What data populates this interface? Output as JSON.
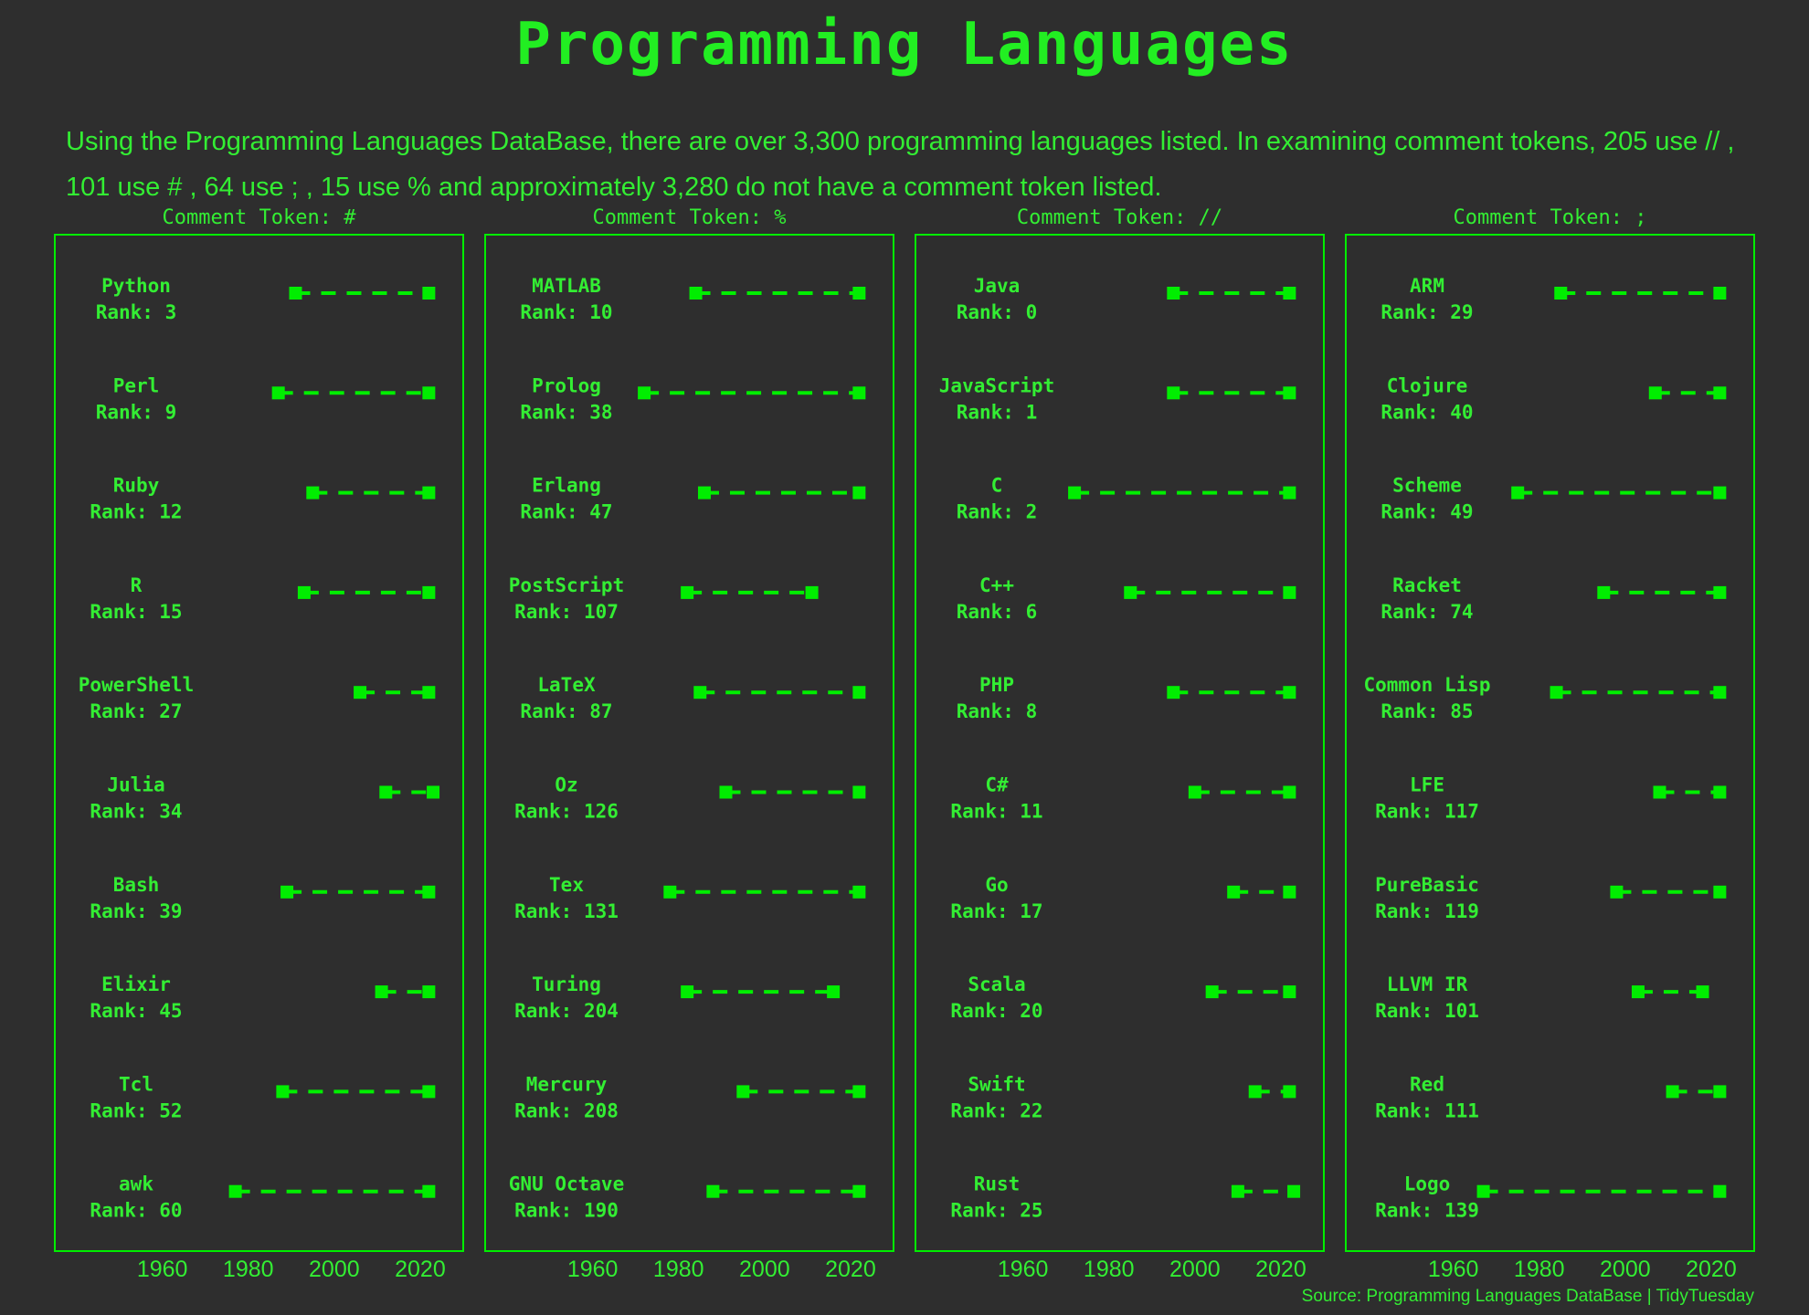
{
  "title": "Programming Languages",
  "subtitle": "Using the Programming Languages DataBase, there are over 3,300 programming languages listed. In examining comment tokens, 205 use // , 101 use # , 64 use ; , 15 use % and approximately 3,280 do not have a comment token listed.",
  "source": "Source: Programming Languages DataBase | TidyTuesday",
  "colors": {
    "background": "#2e2e2e",
    "accent": "#00ee00",
    "text": "#33ee33"
  },
  "chart_data": {
    "type": "dumbbell",
    "xlim": [
      1935,
      2030
    ],
    "xticks": [
      1960,
      1980,
      2000,
      2020
    ],
    "grid": false,
    "panels": [
      {
        "title": "Comment Token: #",
        "languages": [
          {
            "name": "Python",
            "rank_label": "Rank: 3",
            "start": 1991,
            "end": 2022
          },
          {
            "name": "Perl",
            "rank_label": "Rank: 9",
            "start": 1987,
            "end": 2022
          },
          {
            "name": "Ruby",
            "rank_label": "Rank: 12",
            "start": 1995,
            "end": 2022
          },
          {
            "name": "R",
            "rank_label": "Rank: 15",
            "start": 1993,
            "end": 2022
          },
          {
            "name": "PowerShell",
            "rank_label": "Rank: 27",
            "start": 2006,
            "end": 2022
          },
          {
            "name": "Julia",
            "rank_label": "Rank: 34",
            "start": 2012,
            "end": 2023
          },
          {
            "name": "Bash",
            "rank_label": "Rank: 39",
            "start": 1989,
            "end": 2022
          },
          {
            "name": "Elixir",
            "rank_label": "Rank: 45",
            "start": 2011,
            "end": 2022
          },
          {
            "name": "Tcl",
            "rank_label": "Rank: 52",
            "start": 1988,
            "end": 2022
          },
          {
            "name": "awk",
            "rank_label": "Rank: 60",
            "start": 1977,
            "end": 2022
          }
        ]
      },
      {
        "title": "Comment Token: %",
        "languages": [
          {
            "name": "MATLAB",
            "rank_label": "Rank: 10",
            "start": 1984,
            "end": 2022
          },
          {
            "name": "Prolog",
            "rank_label": "Rank: 38",
            "start": 1972,
            "end": 2022
          },
          {
            "name": "Erlang",
            "rank_label": "Rank: 47",
            "start": 1986,
            "end": 2022
          },
          {
            "name": "PostScript",
            "rank_label": "Rank: 107",
            "start": 1982,
            "end": 2011
          },
          {
            "name": "LaTeX",
            "rank_label": "Rank: 87",
            "start": 1985,
            "end": 2022
          },
          {
            "name": "Oz",
            "rank_label": "Rank: 126",
            "start": 1991,
            "end": 2022
          },
          {
            "name": "Tex",
            "rank_label": "Rank: 131",
            "start": 1978,
            "end": 2022
          },
          {
            "name": "Turing",
            "rank_label": "Rank: 204",
            "start": 1982,
            "end": 2016
          },
          {
            "name": "Mercury",
            "rank_label": "Rank: 208",
            "start": 1995,
            "end": 2022
          },
          {
            "name": "GNU Octave",
            "rank_label": "Rank: 190",
            "start": 1988,
            "end": 2022
          }
        ]
      },
      {
        "title": "Comment Token: //",
        "languages": [
          {
            "name": "Java",
            "rank_label": "Rank: 0",
            "start": 1995,
            "end": 2022
          },
          {
            "name": "JavaScript",
            "rank_label": "Rank: 1",
            "start": 1995,
            "end": 2022
          },
          {
            "name": "C",
            "rank_label": "Rank: 2",
            "start": 1972,
            "end": 2022
          },
          {
            "name": "C++",
            "rank_label": "Rank: 6",
            "start": 1985,
            "end": 2022
          },
          {
            "name": "PHP",
            "rank_label": "Rank: 8",
            "start": 1995,
            "end": 2022
          },
          {
            "name": "C#",
            "rank_label": "Rank: 11",
            "start": 2000,
            "end": 2022
          },
          {
            "name": "Go",
            "rank_label": "Rank: 17",
            "start": 2009,
            "end": 2022
          },
          {
            "name": "Scala",
            "rank_label": "Rank: 20",
            "start": 2004,
            "end": 2022
          },
          {
            "name": "Swift",
            "rank_label": "Rank: 22",
            "start": 2014,
            "end": 2022
          },
          {
            "name": "Rust",
            "rank_label": "Rank: 25",
            "start": 2010,
            "end": 2023
          }
        ]
      },
      {
        "title": "Comment Token: ;",
        "languages": [
          {
            "name": "ARM",
            "rank_label": "Rank: 29",
            "start": 1985,
            "end": 2022
          },
          {
            "name": "Clojure",
            "rank_label": "Rank: 40",
            "start": 2007,
            "end": 2022
          },
          {
            "name": "Scheme",
            "rank_label": "Rank: 49",
            "start": 1975,
            "end": 2022
          },
          {
            "name": "Racket",
            "rank_label": "Rank: 74",
            "start": 1995,
            "end": 2022
          },
          {
            "name": "Common Lisp",
            "rank_label": "Rank: 85",
            "start": 1984,
            "end": 2022
          },
          {
            "name": "LFE",
            "rank_label": "Rank: 117",
            "start": 2008,
            "end": 2022
          },
          {
            "name": "PureBasic",
            "rank_label": "Rank: 119",
            "start": 1998,
            "end": 2022
          },
          {
            "name": "LLVM IR",
            "rank_label": "Rank: 101",
            "start": 2003,
            "end": 2018
          },
          {
            "name": "Red",
            "rank_label": "Rank: 111",
            "start": 2011,
            "end": 2022
          },
          {
            "name": "Logo",
            "rank_label": "Rank: 139",
            "start": 1967,
            "end": 2022
          }
        ]
      }
    ]
  }
}
